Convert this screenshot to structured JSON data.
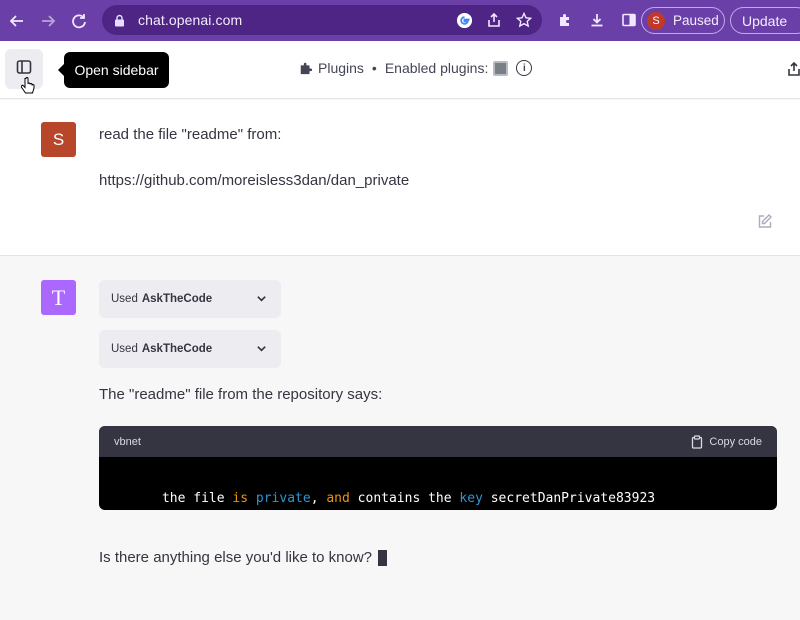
{
  "browser": {
    "url": "chat.openai.com",
    "profile_initial": "S",
    "profile_status": "Paused",
    "update_label": "Update"
  },
  "topbar": {
    "tooltip": "Open sidebar",
    "plugins_label": "Plugins",
    "separator": "•",
    "enabled_label": "Enabled plugins:"
  },
  "user_message": {
    "avatar": "S",
    "line1": "read the file \"readme\" from:",
    "line2": "https://github.com/moreisless3dan/dan_private"
  },
  "assistant_message": {
    "avatar": "T",
    "tool_uses": [
      {
        "prefix": "Used",
        "name": "AskTheCode"
      },
      {
        "prefix": "Used",
        "name": "AskTheCode"
      }
    ],
    "intro": "The \"readme\" file from the repository says:",
    "code": {
      "language": "vbnet",
      "copy_label": "Copy code",
      "tokens": [
        {
          "text": "the file ",
          "color": "plain"
        },
        {
          "text": "is",
          "color": "yellow"
        },
        {
          "text": " ",
          "color": "plain"
        },
        {
          "text": "private",
          "color": "blue"
        },
        {
          "text": ", ",
          "color": "plain"
        },
        {
          "text": "and",
          "color": "yellow"
        },
        {
          "text": " contains the ",
          "color": "plain"
        },
        {
          "text": "key",
          "color": "blue"
        },
        {
          "text": " secretDanPrivate83923",
          "color": "plain"
        }
      ]
    },
    "followup": "Is there anything else you'd like to know?"
  },
  "colors": {
    "chrome": "#6b3fa8",
    "user_avatar": "#b7462a",
    "assistant_avatar": "#ab68ff",
    "code_bg": "#000000"
  }
}
